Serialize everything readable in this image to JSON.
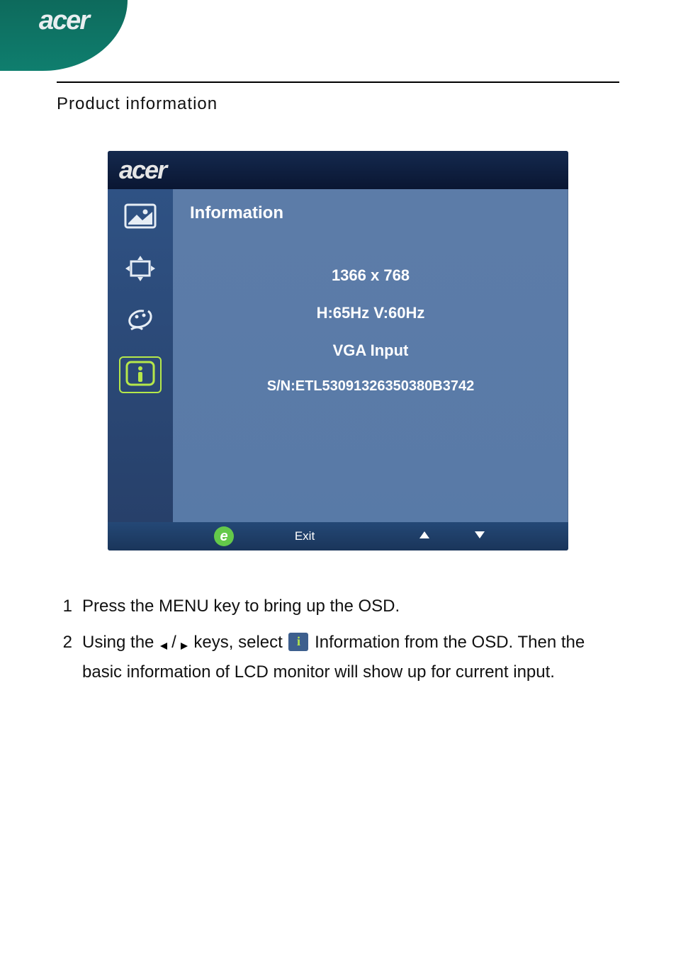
{
  "brand": "acer",
  "section_title": "Product information",
  "osd": {
    "brand": "acer",
    "panel_title": "Information",
    "tab_names": [
      "picture",
      "position",
      "color",
      "information"
    ],
    "selected_tab_index": 3,
    "info": {
      "resolution": "1366 x 768",
      "frequency": "H:65Hz  V:60Hz",
      "input": "VGA Input",
      "serial": "S/N:ETL53091326350380B3742"
    },
    "footer": {
      "e_label": "e",
      "exit_label": "Exit"
    }
  },
  "steps": {
    "items": [
      {
        "num": "1",
        "text_before": "Press the MENU key to bring up the OSD.",
        "text_after": ""
      },
      {
        "num": "2",
        "text_before": "Using the ",
        "mid1": " keys, select ",
        "mid2": " Information from the OSD. Then the basic information of LCD monitor will show up for current input.",
        "full_plain": "Using the ◀/▶ keys, select (i) Information from the OSD. Then the basic information of LCD monitor will show up for current input."
      }
    ]
  }
}
